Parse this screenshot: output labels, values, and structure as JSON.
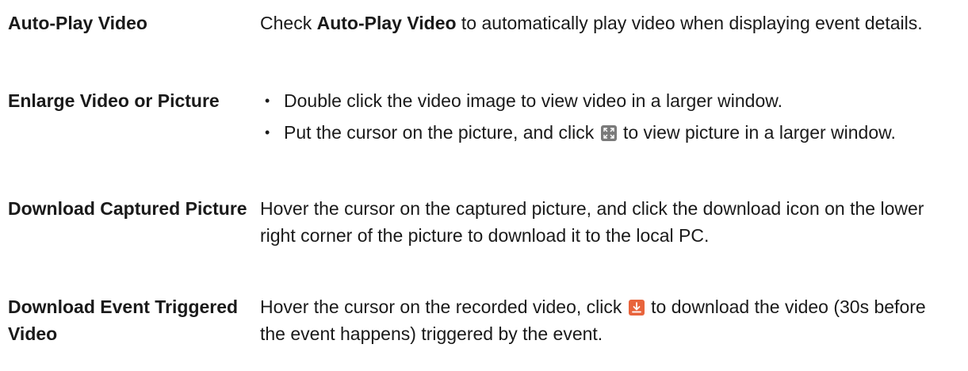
{
  "rows": [
    {
      "term": "Auto-Play Video",
      "desc_prefix": "Check ",
      "desc_bold": "Auto-Play Video",
      "desc_suffix": " to automatically play video when displaying event details."
    },
    {
      "term": "Enlarge Video or Picture",
      "bullets": [
        {
          "text": "Double click the video image to view video in a larger window."
        },
        {
          "text_before": "Put the cursor on the picture, and click ",
          "icon": "expand-icon",
          "text_after": " to view picture in a larger window."
        }
      ]
    },
    {
      "term": "Download Captured Picture",
      "desc": "Hover the cursor on the captured picture, and click the download icon on the lower right corner of the picture to download it to the local PC."
    },
    {
      "term": "Download Event Triggered Video",
      "desc_before": "Hover the cursor on the recorded video, click ",
      "icon": "download-icon",
      "desc_after": " to download the video (30s before the event happens) triggered by the event."
    }
  ],
  "colors": {
    "text": "#1a1a1a",
    "expand_icon_bg": "#7a7a7a",
    "download_icon_bg": "#e8643c"
  }
}
